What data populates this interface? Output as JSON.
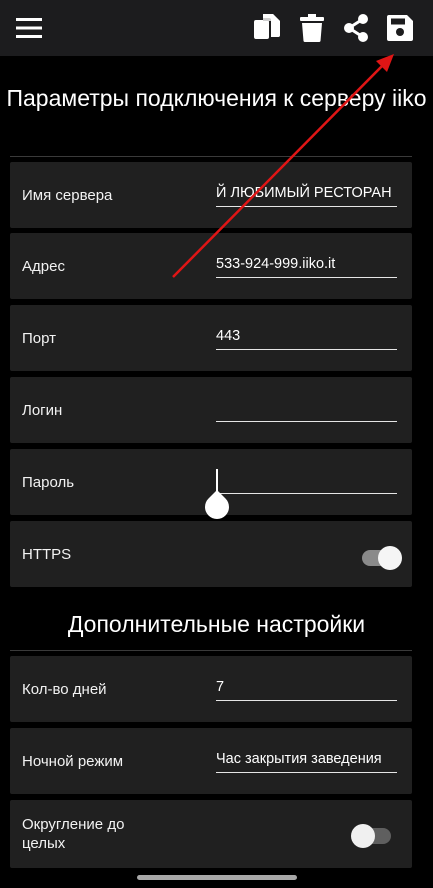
{
  "toolbar": {
    "menu_icon": "hamburger-menu-icon",
    "actions": [
      "copy-icon",
      "trash-icon",
      "share-icon",
      "save-icon"
    ]
  },
  "connection": {
    "title": "Параметры подключения к серверу iiko",
    "server_name": {
      "label": "Имя сервера",
      "value": "Й ЛЮБИМЫЙ РЕСТОРАН"
    },
    "address": {
      "label": "Адрес",
      "value": "533-924-999.iiko.it"
    },
    "port": {
      "label": "Порт",
      "value": "443"
    },
    "login": {
      "label": "Логин",
      "value": ""
    },
    "password": {
      "label": "Пароль",
      "value": ""
    },
    "https": {
      "label": "HTTPS",
      "on": true
    }
  },
  "additional": {
    "title": "Дополнительные настройки",
    "days": {
      "label": "Кол-во дней",
      "value": "7"
    },
    "night_mode": {
      "label": "Ночной режим",
      "value": "Час закрытия заведения"
    },
    "rounding": {
      "label": "Округление до целых",
      "on": false
    }
  },
  "colors": {
    "background": "#000000",
    "toolbar": "#1c1c1e",
    "card": "#202020",
    "annotation_arrow": "#e01515"
  }
}
